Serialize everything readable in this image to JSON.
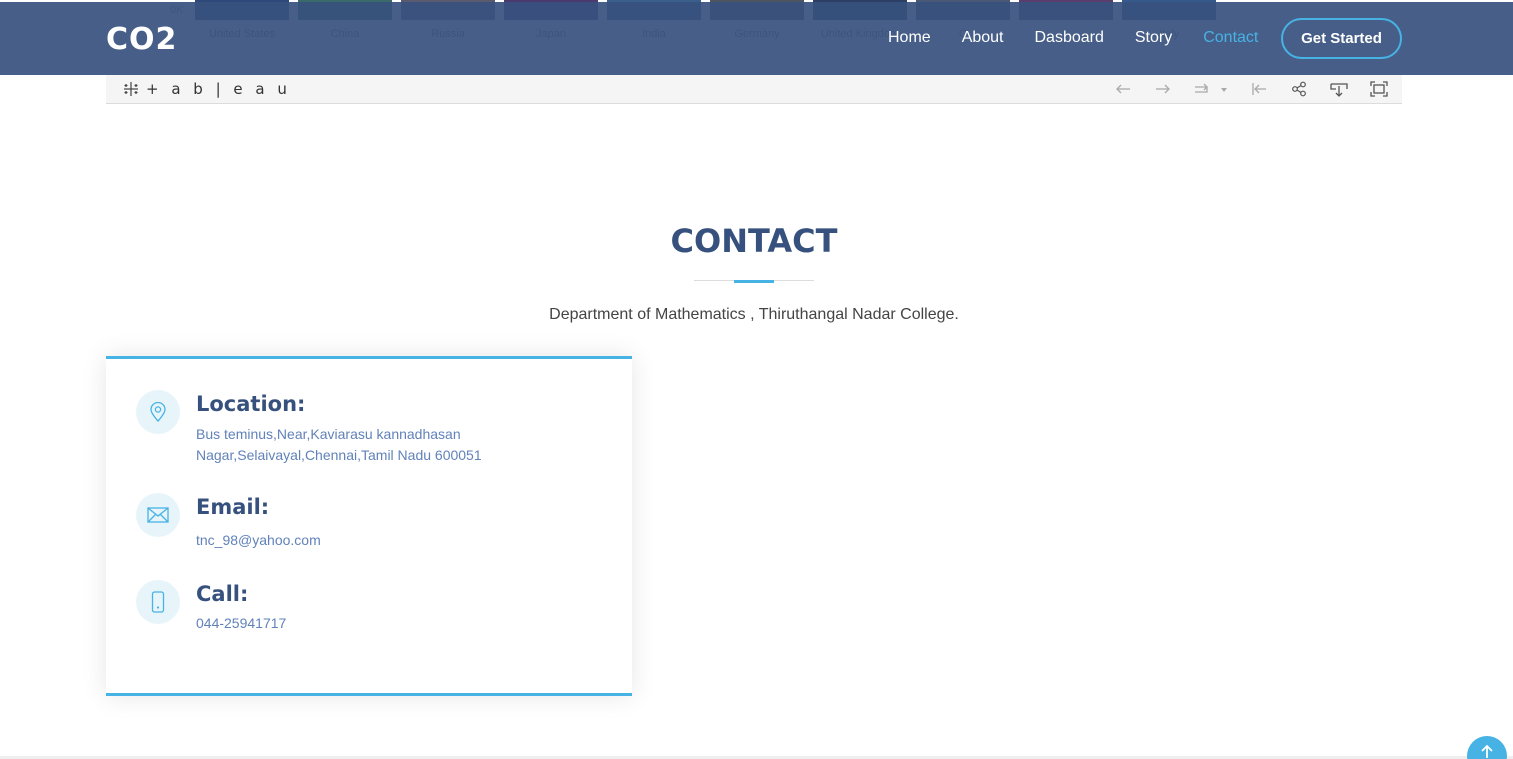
{
  "background_chart": {
    "axis_label": "0K",
    "bars": [
      {
        "label": "United States",
        "color": "#2f4a7a"
      },
      {
        "label": "China",
        "color": "#3b6a6a"
      },
      {
        "label": "Russia",
        "color": "#5a5a6e"
      },
      {
        "label": "Japan",
        "color": "#4a3a6e"
      },
      {
        "label": "India",
        "color": "#3a5f8a"
      },
      {
        "label": "Germany",
        "color": "#4d5560"
      },
      {
        "label": "United Kingdom",
        "color": "#2e3f66"
      },
      {
        "label": "C",
        "color": "#4a5878"
      },
      {
        "label": "",
        "color": "#5a3f6e"
      },
      {
        "label": "Italy",
        "color": "#35598a"
      }
    ]
  },
  "header": {
    "logo": "CO2",
    "nav": [
      {
        "label": "Home",
        "active": false
      },
      {
        "label": "About",
        "active": false
      },
      {
        "label": "Dasboard",
        "active": false
      },
      {
        "label": "Story",
        "active": false
      },
      {
        "label": "Contact",
        "active": true
      }
    ],
    "cta_label": "Get Started"
  },
  "toolbar": {
    "brand": "+ a b | e a u",
    "icons": [
      "undo-icon",
      "redo-icon",
      "revert-icon",
      "dropdown-icon",
      "reset-icon",
      "share-icon",
      "download-icon",
      "fullscreen-icon"
    ]
  },
  "contact": {
    "title": "CONTACT",
    "subtitle": "Department of Mathematics , Thiruthangal Nadar College.",
    "location": {
      "title": "Location:",
      "text": "Bus teminus,Near,Kaviarasu kannadhasan Nagar,Selaivayal,Chennai,Tamil Nadu 600051"
    },
    "email": {
      "title": "Email:",
      "text": "tnc_98@yahoo.com"
    },
    "call": {
      "title": "Call:",
      "text": "044-25941717"
    }
  },
  "colors": {
    "header_bg": "#37517e",
    "accent": "#47b2e4",
    "heading": "#37517e",
    "link_text": "#6182ba"
  }
}
